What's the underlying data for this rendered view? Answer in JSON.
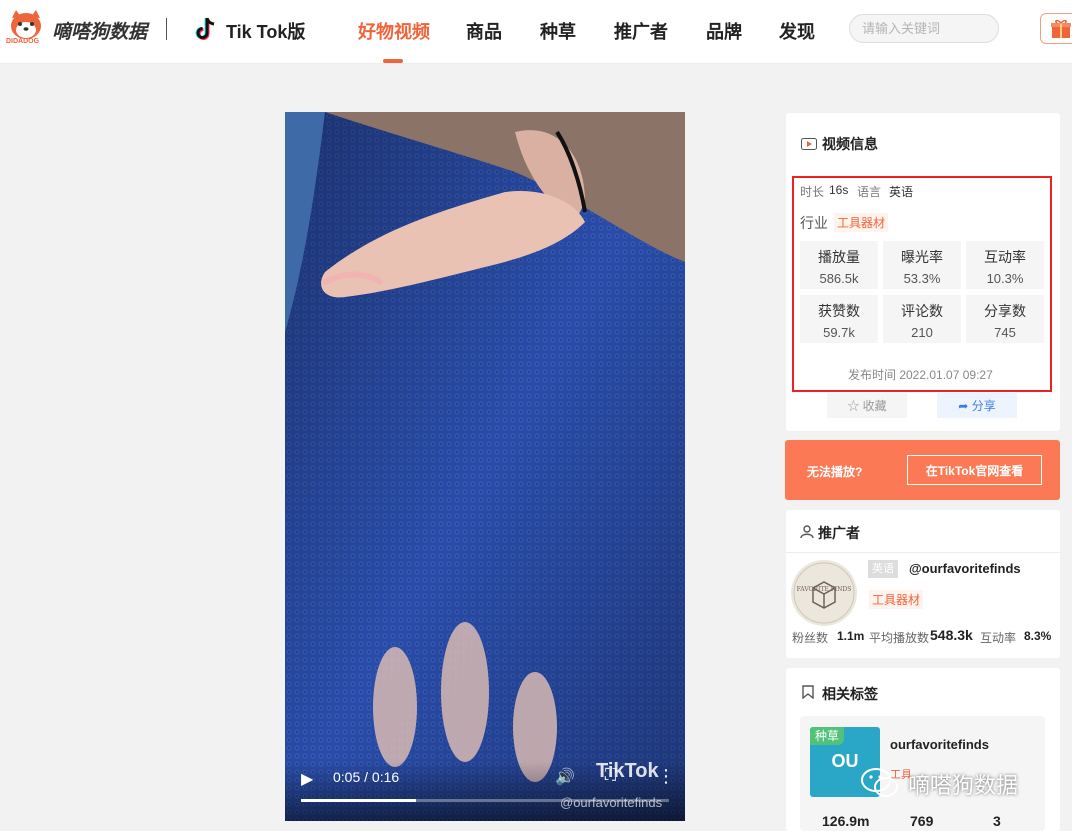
{
  "header": {
    "logo_sub": "DIDADOG",
    "brand": "嘀嗒狗数据",
    "platform": "Tik Tok版",
    "nav": [
      "好物视频",
      "商品",
      "种草",
      "推广者",
      "品牌",
      "发现"
    ],
    "active_nav": "好物视频",
    "search_placeholder": "请输入关键词"
  },
  "video": {
    "time": "0:05 / 0:16",
    "progress": 0.3125,
    "watermark_logo": "TikTok",
    "watermark_handle": "@ourfavoritefinds"
  },
  "video_info": {
    "title": "视频信息",
    "duration_label": "时长",
    "duration": "16s",
    "language_label": "语言",
    "language": "英语",
    "industry_label": "行业",
    "industry": "工具器材",
    "stats": [
      {
        "label": "播放量",
        "value": "586.5k"
      },
      {
        "label": "曝光率",
        "value": "53.3%"
      },
      {
        "label": "互动率",
        "value": "10.3%"
      },
      {
        "label": "获赞数",
        "value": "59.7k"
      },
      {
        "label": "评论数",
        "value": "210"
      },
      {
        "label": "分享数",
        "value": "745"
      }
    ],
    "publish_time": "发布时间 2022.01.07 09:27",
    "favorite_label": "收藏",
    "share_label": "分享"
  },
  "cant_play": {
    "question": "无法播放?",
    "button": "在TikTok官网查看"
  },
  "promoter": {
    "title": "推广者",
    "avatar_text": "FAVORITE FINDS",
    "language": "英语",
    "handle": "@ourfavoritefinds",
    "category": "工具器材",
    "fans_label": "粉丝数",
    "fans": "1.1m",
    "avg_play_label": "平均播放数",
    "avg_play": "548.3k",
    "engagement_label": "互动率",
    "engagement": "8.3%"
  },
  "related_tags": {
    "title": "相关标签",
    "badge": "种草",
    "thumb_text": "OU",
    "name": "ourfavoritefinds",
    "kind": "工具",
    "numbers": [
      "126.9m",
      "769",
      "3"
    ]
  },
  "overlay": {
    "wechat_text": "嘀嗒狗数据"
  },
  "colors": {
    "accent": "#f0643c",
    "orange_banner": "#fb7a55",
    "highlight_box": "#e22222",
    "video_bg": "#1f3c8f"
  }
}
